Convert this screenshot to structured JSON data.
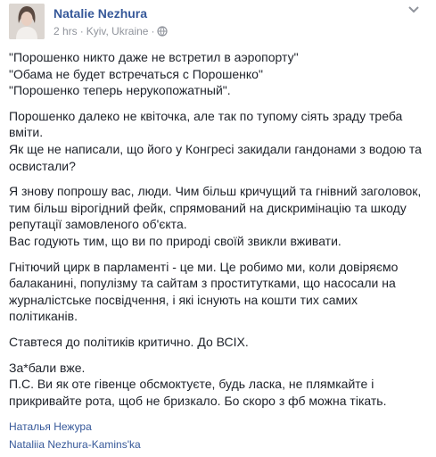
{
  "post": {
    "author": "Natalie Nezhura",
    "time": "2 hrs",
    "location": "Kyiv, Ukraine",
    "separator": "·",
    "paragraphs": [
      {
        "lines": [
          "\"Порошенко никто даже не встретил в аэропорту\"",
          "\"Обама не будет встречаться с Порошенко\"",
          "\"Порошенко теперь нерукопожатный\"."
        ]
      },
      {
        "lines": [
          "Порошенко далеко не квіточка, але так по тупому сіять зраду треба",
          "вміти.",
          "Як ще не написали, що його у Конгресі закидали гандонами з водою та",
          "освистали?"
        ]
      },
      {
        "lines": [
          "Я знову попрошу вас, люди. Чим більш кричущий та гнівний заголовок,",
          "тим більш вірогідний фейк, спрямований на дискримінацію та шкоду",
          "репутації замовленого об'єкта.",
          "Вас годують тим, що ви по природі своїй звикли вживати."
        ]
      },
      {
        "lines": [
          "Гнітючий цирк в парламенті - це ми. Це робимо ми, коли довіряємо",
          "балаканині, популізму та сайтам з проституткам​и, що насосали на",
          "журналістське посвідчення, і які існують на кошти тих самих",
          "політиканів."
        ]
      },
      {
        "lines": [
          "Ставтеся до політиків критично. До ВСІХ."
        ]
      },
      {
        "lines": [
          "За*бали вже.",
          "П.С. Ви як оте гівенце обсмоктуєте, будь ласка, не плямкайте і",
          "прикривайте рота, щоб не бризкало. Бо скоро з фб можна тікать."
        ]
      }
    ],
    "signature": [
      "Наталья Нежура",
      "Nataliia Nezhura-Kamins'ka"
    ]
  },
  "icons": {
    "chevron": "chevron-down-icon",
    "globe": "globe-icon",
    "avatar": "avatar"
  },
  "colors": {
    "author": "#365899",
    "meta": "#90949c",
    "text": "#1d2129",
    "link": "#365899"
  }
}
